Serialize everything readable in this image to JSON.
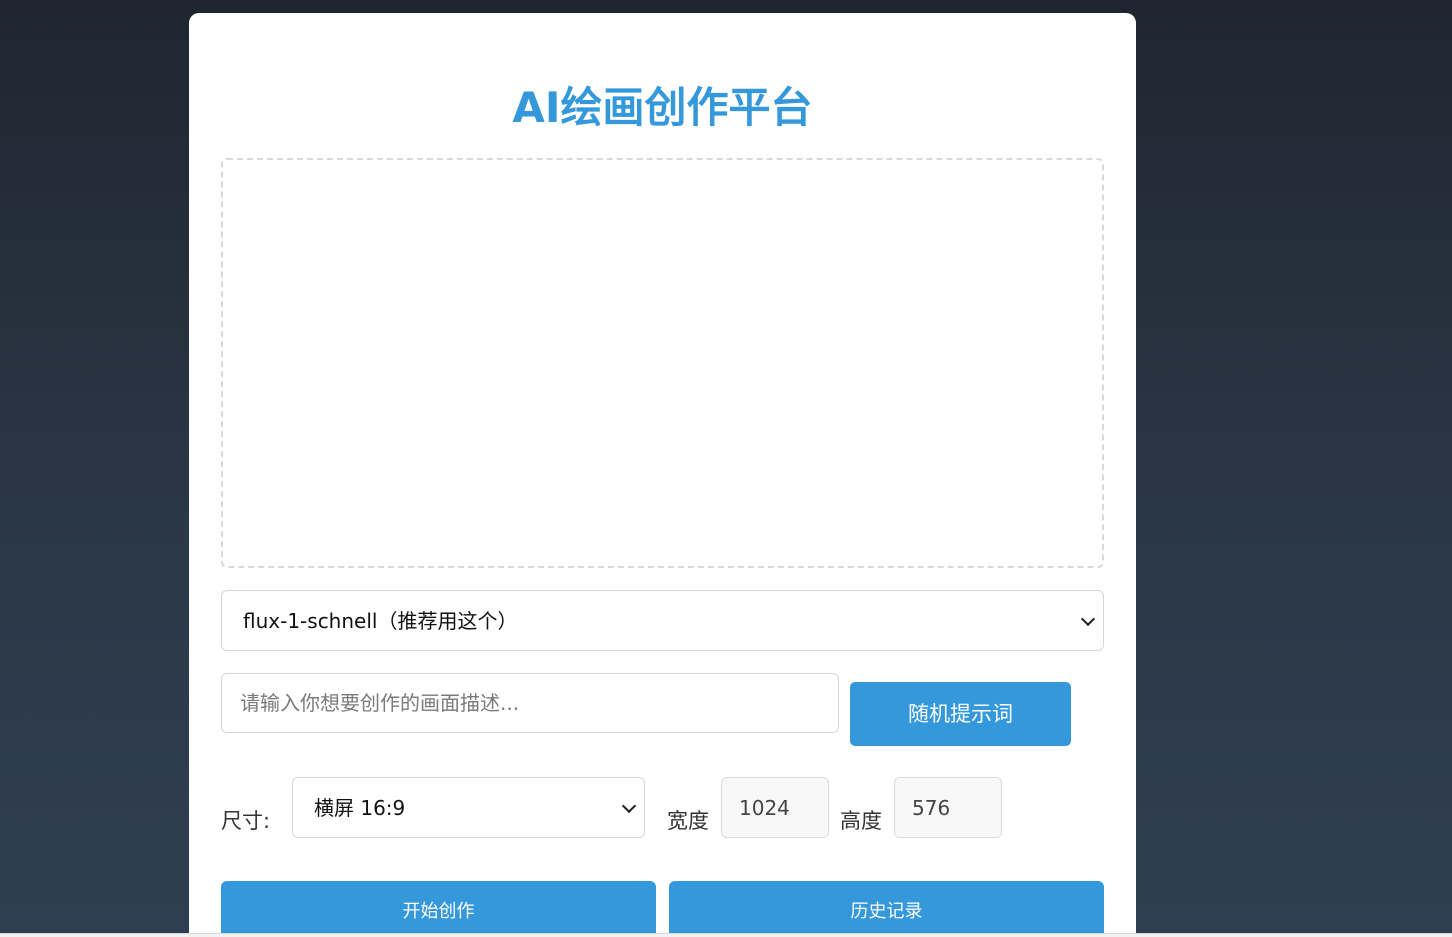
{
  "page": {
    "title": "AI绘画创作平台"
  },
  "model": {
    "selected": "flux-1-schnell（推荐用这个）"
  },
  "prompt": {
    "placeholder": "请输入你想要创作的画面描述...",
    "random_button": "随机提示词"
  },
  "size": {
    "label": "尺寸:",
    "selected": "横屏 16:9",
    "width_label": "宽度",
    "width_value": "1024",
    "height_label": "高度",
    "height_value": "576"
  },
  "actions": {
    "start": "开始创作",
    "history": "历史记录"
  },
  "colors": {
    "accent": "#3498db",
    "card_bg": "#ffffff"
  }
}
